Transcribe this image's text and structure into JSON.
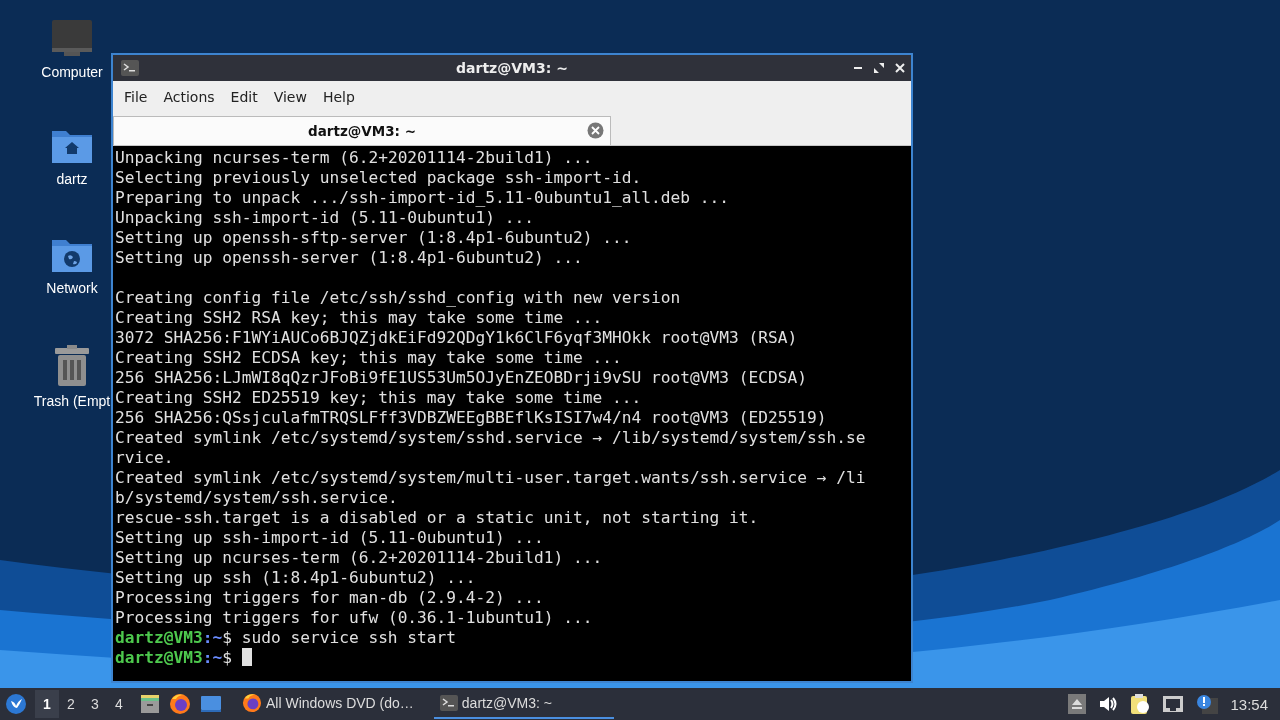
{
  "desktop_icons": [
    {
      "kind": "computer",
      "label": "Computer"
    },
    {
      "kind": "home",
      "label": "dartz"
    },
    {
      "kind": "network",
      "label": "Network"
    },
    {
      "kind": "trash",
      "label": "Trash (Empt"
    }
  ],
  "window": {
    "title": "dartz@VM3: ~"
  },
  "menu": [
    "File",
    "Actions",
    "Edit",
    "View",
    "Help"
  ],
  "tabs": [
    {
      "label": "dartz@VM3: ~",
      "selected": true
    }
  ],
  "terminal": [
    {
      "kind": "output",
      "text": "Unpacking ncurses-term (6.2+20201114-2build1) ..."
    },
    {
      "kind": "output",
      "text": "Selecting previously unselected package ssh-import-id."
    },
    {
      "kind": "output",
      "text": "Preparing to unpack .../ssh-import-id_5.11-0ubuntu1_all.deb ..."
    },
    {
      "kind": "output",
      "text": "Unpacking ssh-import-id (5.11-0ubuntu1) ..."
    },
    {
      "kind": "output",
      "text": "Setting up openssh-sftp-server (1:8.4p1-6ubuntu2) ..."
    },
    {
      "kind": "output",
      "text": "Setting up openssh-server (1:8.4p1-6ubuntu2) ..."
    },
    {
      "kind": "blank"
    },
    {
      "kind": "output",
      "text": "Creating config file /etc/ssh/sshd_config with new version"
    },
    {
      "kind": "output",
      "text": "Creating SSH2 RSA key; this may take some time ..."
    },
    {
      "kind": "output",
      "text": "3072 SHA256:F1WYiAUCo6BJQZjdkEiFd92QDgY1k6ClF6yqf3MHOkk root@VM3 (RSA)"
    },
    {
      "kind": "output",
      "text": "Creating SSH2 ECDSA key; this may take some time ..."
    },
    {
      "kind": "output",
      "text": "256 SHA256:LJmWI8qQzrJFoBi9fE1US53Um5OJyEnZEOBDrji9vSU root@VM3 (ECDSA)"
    },
    {
      "kind": "output",
      "text": "Creating SSH2 ED25519 key; this may take some time ..."
    },
    {
      "kind": "output",
      "text": "256 SHA256:QSsjculafmTRQSLFff3VDBZWEEgBBEflKsISI7w4/n4 root@VM3 (ED25519)"
    },
    {
      "kind": "output",
      "text": "Created symlink /etc/systemd/system/sshd.service → /lib/systemd/system/ssh.se"
    },
    {
      "kind": "output",
      "text": "rvice."
    },
    {
      "kind": "output",
      "text": "Created symlink /etc/systemd/system/multi-user.target.wants/ssh.service → /li"
    },
    {
      "kind": "output",
      "text": "b/systemd/system/ssh.service."
    },
    {
      "kind": "output",
      "text": "rescue-ssh.target is a disabled or a static unit, not starting it."
    },
    {
      "kind": "output",
      "text": "Setting up ssh-import-id (5.11-0ubuntu1) ..."
    },
    {
      "kind": "output",
      "text": "Setting up ncurses-term (6.2+20201114-2build1) ..."
    },
    {
      "kind": "output",
      "text": "Setting up ssh (1:8.4p1-6ubuntu2) ..."
    },
    {
      "kind": "output",
      "text": "Processing triggers for man-db (2.9.4-2) ..."
    },
    {
      "kind": "output",
      "text": "Processing triggers for ufw (0.36.1-1ubuntu1) ..."
    },
    {
      "kind": "prompt",
      "user": "dartz@VM3",
      "sep": ":",
      "path": "~",
      "symbol": "$",
      "command": "sudo service ssh start"
    },
    {
      "kind": "prompt",
      "user": "dartz@VM3",
      "sep": ":",
      "path": "~",
      "symbol": "$",
      "cursor": true
    }
  ],
  "taskbar": {
    "workspaces": [
      {
        "label": "1",
        "selected": true
      },
      {
        "label": "2",
        "selected": false
      },
      {
        "label": "3",
        "selected": false
      },
      {
        "label": "4",
        "selected": false
      }
    ],
    "launchers": [
      {
        "kind": "files"
      },
      {
        "kind": "browser"
      },
      {
        "kind": "desktop"
      }
    ],
    "tasks": [
      {
        "kind": "browser",
        "label": "All Windows DVD (do…",
        "selected": false
      },
      {
        "kind": "terminal",
        "label": "dartz@VM3: ~",
        "selected": true
      }
    ],
    "clock": "13:54"
  }
}
